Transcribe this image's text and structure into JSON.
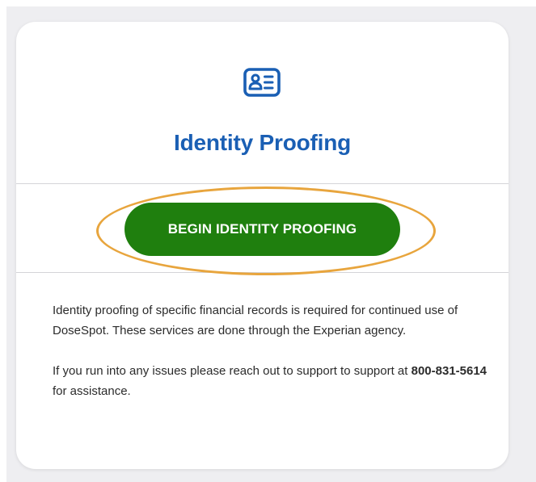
{
  "card": {
    "icon": "id-card-icon",
    "title": "Identity Proofing",
    "begin_button_label": "BEGIN IDENTITY PROOFING",
    "paragraph1": "Identity proofing of specific financial records is required for continued use of DoseSpot. These services are done through the Experian agency.",
    "paragraph2_before": "If you run into any issues please reach out to support to support at ",
    "phone": "800-831-5614",
    "paragraph2_after": " for assistance."
  },
  "colors": {
    "title": "#1a5fb4",
    "button": "#1f7f0e",
    "highlight_ring": "#e8a53d",
    "backdrop": "#eeeef1"
  }
}
